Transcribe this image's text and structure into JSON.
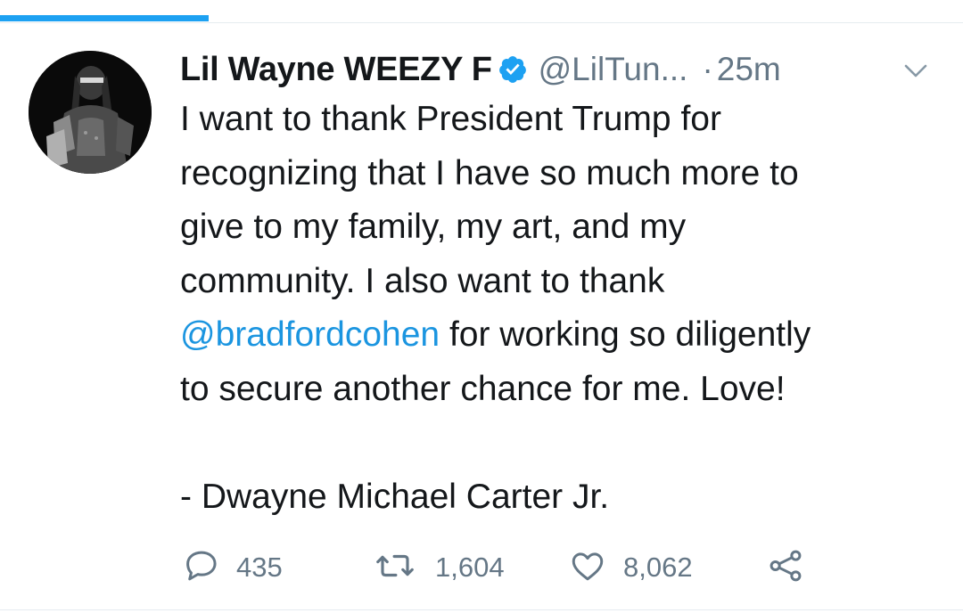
{
  "tweet": {
    "author": {
      "display_name": "Lil Wayne WEEZY F",
      "handle": "@LilTun...",
      "verified": true
    },
    "separator": "·",
    "timestamp": "25m",
    "body_lines": [
      {
        "text": "I want to thank President Trump for"
      },
      {
        "text": "recognizing that I have so much more to"
      },
      {
        "text": "give to my family, my art, and my"
      },
      {
        "text": "community. I also want to thank"
      },
      {
        "mention": "@bradfordcohen",
        "text": " for working so diligently"
      },
      {
        "text": "to secure another chance for me. Love!"
      },
      {
        "text": ""
      },
      {
        "text": "- Dwayne Michael Carter Jr."
      }
    ],
    "actions": {
      "replies": "435",
      "retweets": "1,604",
      "likes": "8,062"
    }
  },
  "icons": {
    "verified": "verified-badge-icon",
    "menu": "chevron-down-icon",
    "reply": "reply-icon",
    "retweet": "retweet-icon",
    "like": "heart-icon",
    "share": "share-icon"
  },
  "colors": {
    "accent": "#1da1f2",
    "mention": "#1b95e0",
    "text": "#14171a",
    "secondary": "#657786"
  }
}
